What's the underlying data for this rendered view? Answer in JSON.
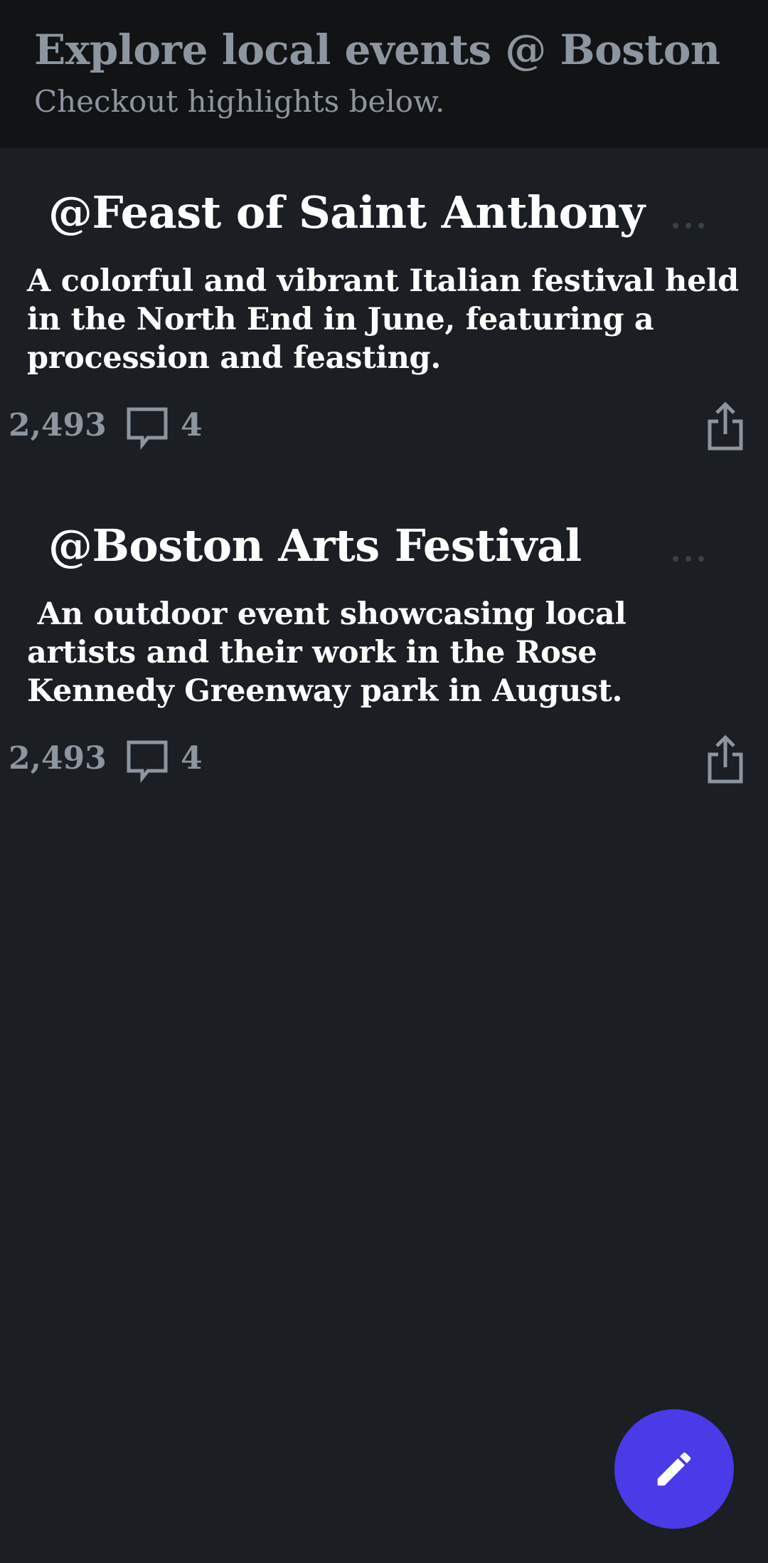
{
  "header": {
    "title": "Explore local events @ Boston",
    "subtitle": "Checkout highlights below."
  },
  "events": [
    {
      "title": "@Feast of Saint Anthony",
      "description": "A colorful and vibrant Italian festival held in the North End in June, featuring a procession and feasting.",
      "views": "2,493",
      "comments": "4"
    },
    {
      "title": "@Boston Arts Festival",
      "description": " An outdoor event showcasing local artists and their work in the Rose Kennedy Greenway park in August.",
      "views": "2,493",
      "comments": "4"
    }
  ],
  "fab": {
    "icon": "pencil-icon"
  },
  "colors": {
    "background": "#1b1e22",
    "header_background": "#121315",
    "accent": "#4a3ae8",
    "muted_text": "#8d96a0"
  }
}
